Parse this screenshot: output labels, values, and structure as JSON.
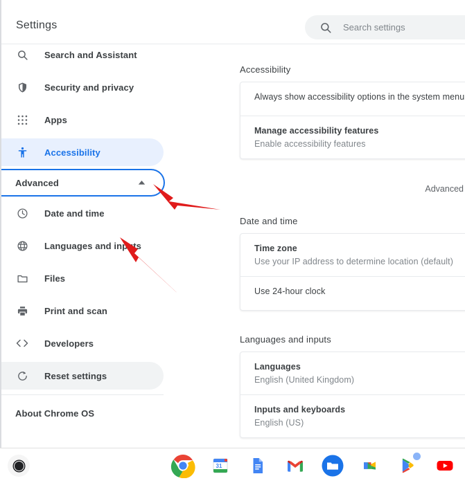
{
  "window": {
    "app_title": "Settings"
  },
  "search": {
    "placeholder": "Search settings",
    "value": "",
    "icon": "search-icon"
  },
  "sidebar": {
    "items": [
      {
        "label": "Search and Assistant",
        "icon": "search-icon",
        "state": "normal"
      },
      {
        "label": "Security and privacy",
        "icon": "shield-icon",
        "state": "normal"
      },
      {
        "label": "Apps",
        "icon": "grid-apps-icon",
        "state": "normal"
      },
      {
        "label": "Accessibility",
        "icon": "accessibility-person-icon",
        "state": "selected"
      }
    ],
    "advanced": {
      "label": "Advanced",
      "chevron": "chevron-up-icon",
      "expanded": true,
      "focus_ring_color": "#1a73e8"
    },
    "advanced_items": [
      {
        "label": "Date and time",
        "icon": "clock-icon",
        "state": "normal"
      },
      {
        "label": "Languages and inputs",
        "icon": "globe-icon",
        "state": "normal"
      },
      {
        "label": "Files",
        "icon": "folder-icon",
        "state": "normal"
      },
      {
        "label": "Print and scan",
        "icon": "printer-icon",
        "state": "normal"
      },
      {
        "label": "Developers",
        "icon": "code-brackets-icon",
        "state": "normal"
      },
      {
        "label": "Reset settings",
        "icon": "reset-refresh-icon",
        "state": "hovered"
      }
    ],
    "about": {
      "label": "About Chrome OS"
    }
  },
  "content": {
    "advanced_link": "Advanced",
    "sections": [
      {
        "title": "Accessibility",
        "rows": [
          {
            "primary": "Always show accessibility options in the system menu",
            "secondary": "",
            "primary_weight": "normal"
          },
          {
            "primary": "Manage accessibility features",
            "secondary": "Enable accessibility features",
            "primary_weight": "bold"
          }
        ]
      },
      {
        "title": "Date and time",
        "rows": [
          {
            "primary": "Time zone",
            "secondary": "Use your IP address to determine location (default)",
            "primary_weight": "bold"
          },
          {
            "primary": "Use 24-hour clock",
            "secondary": "",
            "primary_weight": "normal"
          }
        ]
      },
      {
        "title": "Languages and inputs",
        "rows": [
          {
            "primary": "Languages",
            "secondary": "English (United Kingdom)",
            "primary_weight": "bold"
          },
          {
            "primary": "Inputs and keyboards",
            "secondary": "English (US)",
            "primary_weight": "bold"
          }
        ]
      }
    ]
  },
  "shelf": {
    "launcher": {
      "name": "launcher-button"
    },
    "apps": [
      {
        "name": "chrome-icon",
        "label": "Chrome",
        "badge": false
      },
      {
        "name": "google-calendar-icon",
        "label": "Calendar",
        "day": "31",
        "badge": false
      },
      {
        "name": "google-docs-icon",
        "label": "Docs",
        "badge": false
      },
      {
        "name": "gmail-icon",
        "label": "Gmail",
        "badge": false
      },
      {
        "name": "files-icon",
        "label": "Files",
        "badge": false
      },
      {
        "name": "google-meet-icon",
        "label": "Meet",
        "badge": false
      },
      {
        "name": "play-store-icon",
        "label": "Play Store",
        "badge": true
      },
      {
        "name": "youtube-icon",
        "label": "YouTube",
        "badge": false
      }
    ]
  },
  "annotations": {
    "color": "#e01b1b",
    "arrows": [
      {
        "name": "arrow-to-advanced-toggle",
        "points_to": "Advanced"
      },
      {
        "name": "arrow-to-languages-and-inputs",
        "points_to": "Languages and inputs"
      }
    ]
  }
}
